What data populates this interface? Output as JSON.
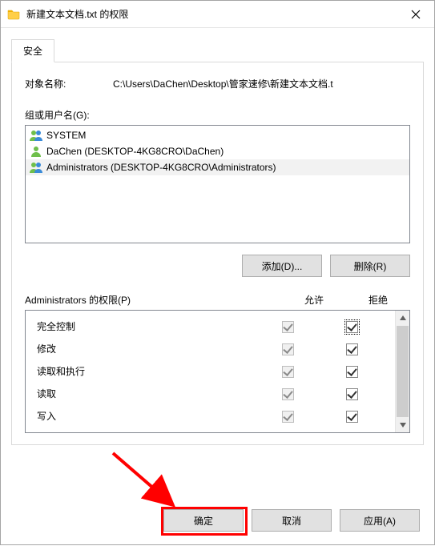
{
  "window": {
    "title": "新建文本文档.txt 的权限",
    "close_icon": "×"
  },
  "tabs": {
    "security": "安全"
  },
  "object": {
    "label": "对象名称:",
    "path": "C:\\Users\\DaChen\\Desktop\\管家速修\\新建文本文档.t"
  },
  "groups": {
    "label": "组或用户名(G):",
    "items": [
      {
        "name": "SYSTEM",
        "icon": "group"
      },
      {
        "name": "DaChen (DESKTOP-4KG8CRO\\DaChen)",
        "icon": "user"
      },
      {
        "name": "Administrators (DESKTOP-4KG8CRO\\Administrators)",
        "icon": "group",
        "selected": true
      }
    ]
  },
  "buttons": {
    "add": "添加(D)...",
    "remove": "删除(R)",
    "ok": "确定",
    "cancel": "取消",
    "apply": "应用(A)"
  },
  "perm_header": {
    "title": "Administrators 的权限(P)",
    "allow": "允许",
    "deny": "拒绝"
  },
  "permissions": [
    {
      "name": "完全控制",
      "allow": true,
      "allow_enabled": false,
      "deny": true,
      "deny_focus": true
    },
    {
      "name": "修改",
      "allow": true,
      "allow_enabled": false,
      "deny": true
    },
    {
      "name": "读取和执行",
      "allow": true,
      "allow_enabled": false,
      "deny": true
    },
    {
      "name": "读取",
      "allow": true,
      "allow_enabled": false,
      "deny": true
    },
    {
      "name": "写入",
      "allow": true,
      "allow_enabled": false,
      "deny": true
    }
  ],
  "annotation": {
    "highlight_button": "ok",
    "arrow": true
  }
}
